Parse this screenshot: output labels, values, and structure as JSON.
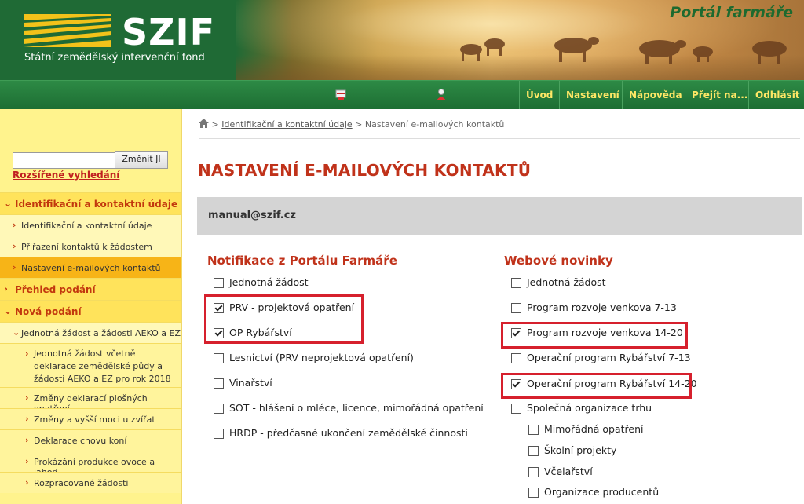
{
  "header": {
    "logo_text": "SZIF",
    "logo_subtitle": "Státní zemědělský intervenční fond",
    "portal_title": "Portál farmáře"
  },
  "nav": {
    "items": [
      "Úvod",
      "Nastavení",
      "Nápověda",
      "Přejít na...",
      "Odhlásit"
    ]
  },
  "sidebar": {
    "search_placeholder": "",
    "search_button": "Změnit JI",
    "advanced_search": "Rozšířené vyhledání",
    "items": [
      {
        "label": "Identifikační a kontaktní údaje",
        "level": 0
      },
      {
        "label": "Identifikační a kontaktní údaje",
        "level": 1
      },
      {
        "label": "Přiřazení kontaktů k žádostem",
        "level": 1
      },
      {
        "label": "Nastavení e-mailových kontaktů",
        "level": 1,
        "active": true
      },
      {
        "label": "Přehled podání",
        "level": 0
      },
      {
        "label": "Nová podání",
        "level": 0
      },
      {
        "label": "Jednotná žádost a žádosti AEKO a EZ",
        "level": 1
      },
      {
        "label": "Jednotná žádost včetně deklarace zemědělské půdy a žádosti AEKO a EZ pro rok 2018",
        "level": 2
      },
      {
        "label": "Změny deklarací plošných opatření",
        "level": 2
      },
      {
        "label": "Změny a vyšší moci u zvířat",
        "level": 2
      },
      {
        "label": "Deklarace chovu koní",
        "level": 2
      },
      {
        "label": "Prokázání produkce ovoce a jahod",
        "level": 2
      },
      {
        "label": "Rozpracované žádosti",
        "level": 2
      }
    ]
  },
  "breadcrumb": {
    "link": "Identifikační a kontaktní údaje",
    "separator": ">",
    "current": "Nastavení e-mailových kontaktů"
  },
  "page_title": "NASTAVENÍ E-MAILOVÝCH KONTAKTŮ",
  "email": "manual@szif.cz",
  "notifications": {
    "title": "Notifikace z Portálu Farmáře",
    "items": [
      {
        "label": "Jednotná žádost",
        "checked": false
      },
      {
        "label": "PRV - projektová opatření",
        "checked": true
      },
      {
        "label": "OP Rybářství",
        "checked": true
      },
      {
        "label": "Lesnictví (PRV neprojektová opatření)",
        "checked": false
      },
      {
        "label": "Vinařství",
        "checked": false
      },
      {
        "label": "SOT - hlášení o mléce, licence, mimořádná opatření",
        "checked": false
      },
      {
        "label": "HRDP - předčasné ukončení zemědělské činnosti",
        "checked": false
      }
    ]
  },
  "web_news": {
    "title": "Webové novinky",
    "items": [
      {
        "label": "Jednotná žádost",
        "checked": false
      },
      {
        "label": "Program rozvoje venkova 7-13",
        "checked": false
      },
      {
        "label": "Program rozvoje venkova 14-20",
        "checked": true
      },
      {
        "label": "Operační program Rybářství 7-13",
        "checked": false
      },
      {
        "label": "Operační program Rybářství 14-20",
        "checked": true
      },
      {
        "label": "Společná organizace trhu",
        "checked": false
      },
      {
        "label": "Mimořádná opatření",
        "checked": false
      },
      {
        "label": "Školní projekty",
        "checked": false
      },
      {
        "label": "Včelařství",
        "checked": false
      },
      {
        "label": "Organizace producentů",
        "checked": false
      }
    ]
  },
  "colors": {
    "header_green": "#1f6a35",
    "accent_red": "#c0321a",
    "sidebar_yellow": "#fff38d",
    "highlight_red": "#d6202d"
  }
}
